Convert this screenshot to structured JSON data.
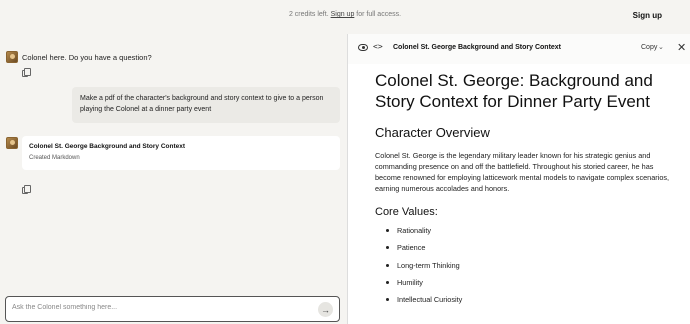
{
  "topbar": {
    "credits_prefix": "2 credits left.",
    "credits_link": "Sign up",
    "credits_suffix": "for full access.",
    "signup_button": "Sign up"
  },
  "chat": {
    "greeting": "Colonel here. Do you have a question?",
    "user_message": "Make a pdf of the character's background and story context to give to a person playing the Colonel at a dinner party event",
    "artifact_title": "Colonel St. George Background and Story Context",
    "artifact_status": "Created Markdown",
    "input_placeholder": "Ask the Colonel something here...",
    "send_icon": "arrow-right-icon"
  },
  "panel": {
    "title": "Colonel St. George Background and Story Context",
    "copy_label": "Copy",
    "icons": [
      "eye-icon",
      "code-icon",
      "chevron-down-icon",
      "close-icon"
    ]
  },
  "document": {
    "heading": "Colonel St. George: Background and Story Context for Dinner Party Event",
    "section1_heading": "Character Overview",
    "section1_body": "Colonel St. George is the legendary military leader known for his strategic genius and commanding presence on and off the battlefield. Throughout his storied career, he has become renowned for employing latticework mental models to navigate complex scenarios, earning numerous accolades and honors.",
    "section2_heading": "Core Values:",
    "values": [
      "Rationality",
      "Patience",
      "Long-term Thinking",
      "Humility",
      "Intellectual Curiosity"
    ]
  }
}
